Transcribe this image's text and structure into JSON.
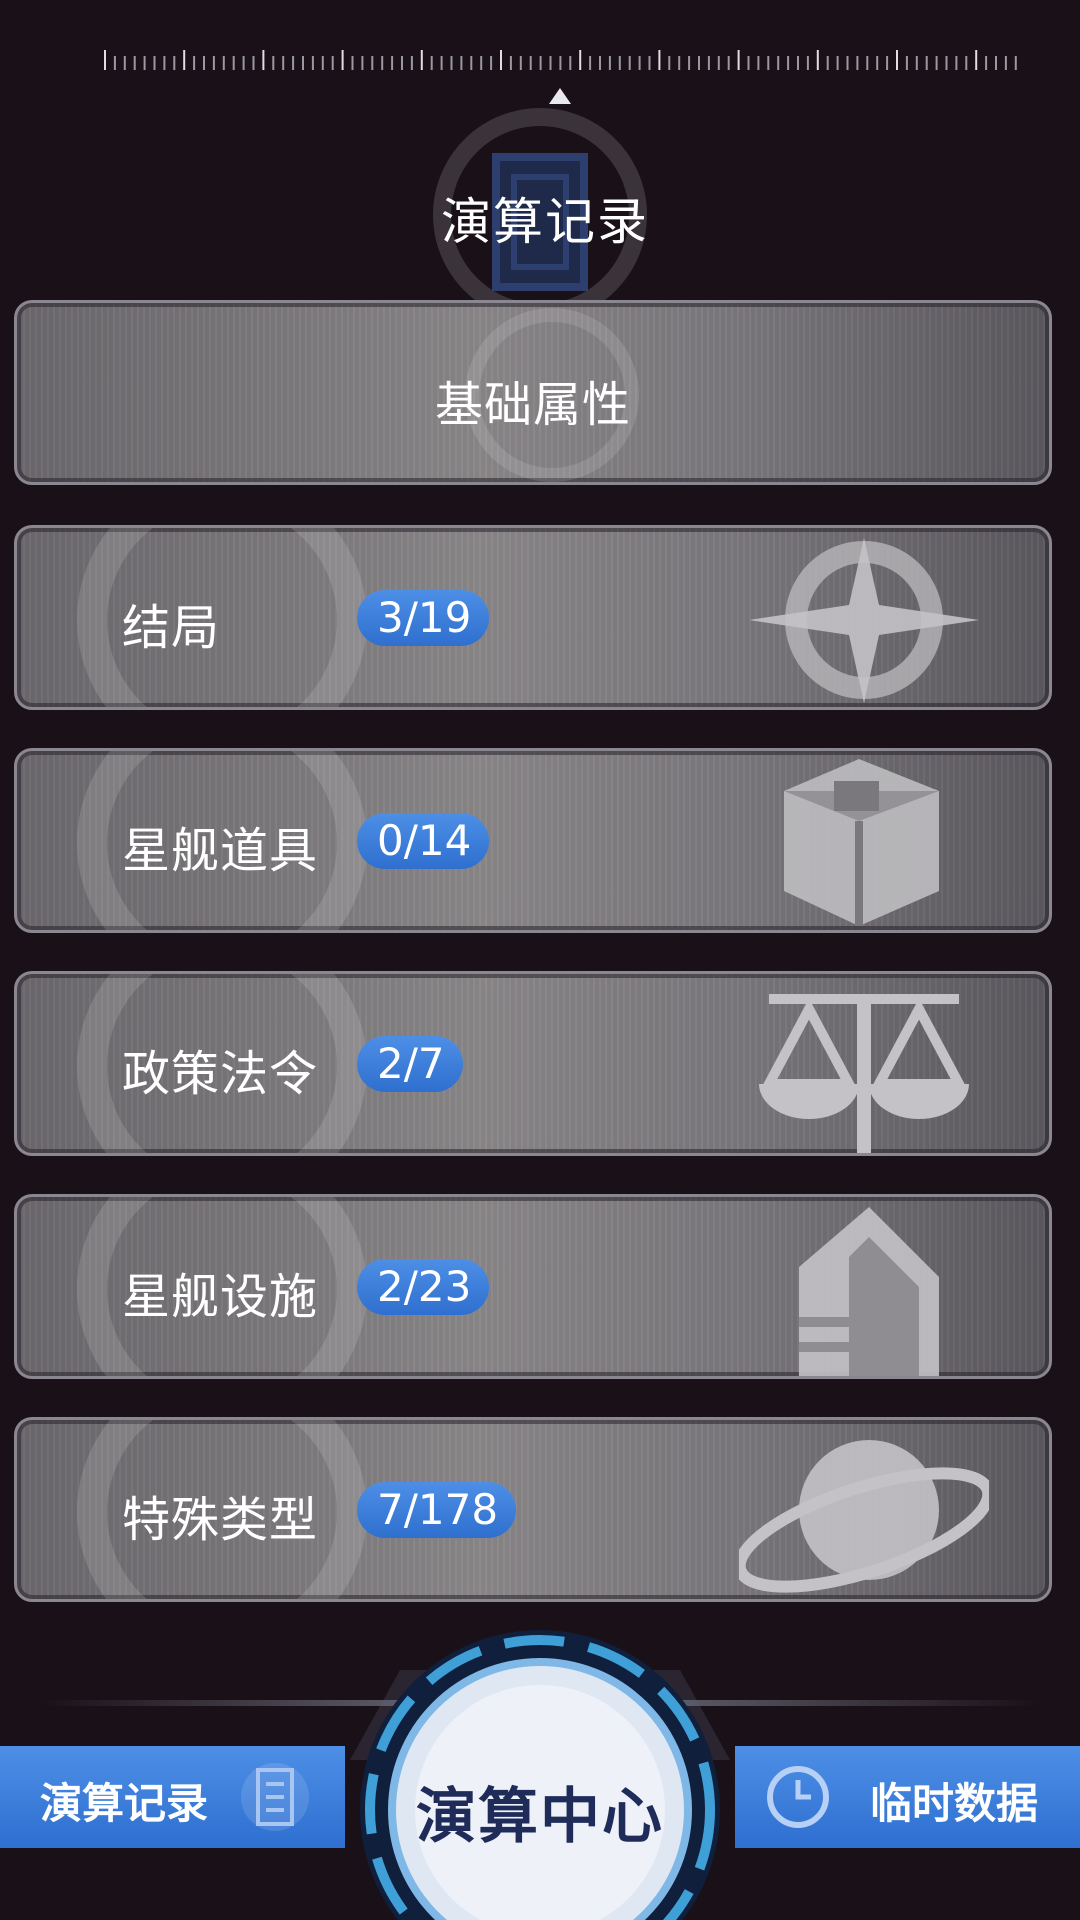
{
  "header": {
    "title": "演算记录"
  },
  "basic_attributes": {
    "label": "基础属性"
  },
  "categories": [
    {
      "label": "结局",
      "progress": "3/19",
      "icon": "compass-star-icon"
    },
    {
      "label": "星舰道具",
      "progress": "0/14",
      "icon": "box-icon"
    },
    {
      "label": "政策法令",
      "progress": "2/7",
      "icon": "scales-icon"
    },
    {
      "label": "星舰设施",
      "progress": "2/23",
      "icon": "building-icon"
    },
    {
      "label": "特殊类型",
      "progress": "7/178",
      "icon": "planet-icon"
    }
  ],
  "bottom_nav": {
    "left": {
      "label": "演算记录",
      "icon": "document-icon"
    },
    "center": {
      "label": "演算中心"
    },
    "right": {
      "label": "临时数据",
      "icon": "clock-icon"
    }
  },
  "colors": {
    "background": "#1a1118",
    "badge_blue": "#3a7ddb",
    "nav_blue": "#3d80de",
    "center_text": "#1f2c5a"
  }
}
